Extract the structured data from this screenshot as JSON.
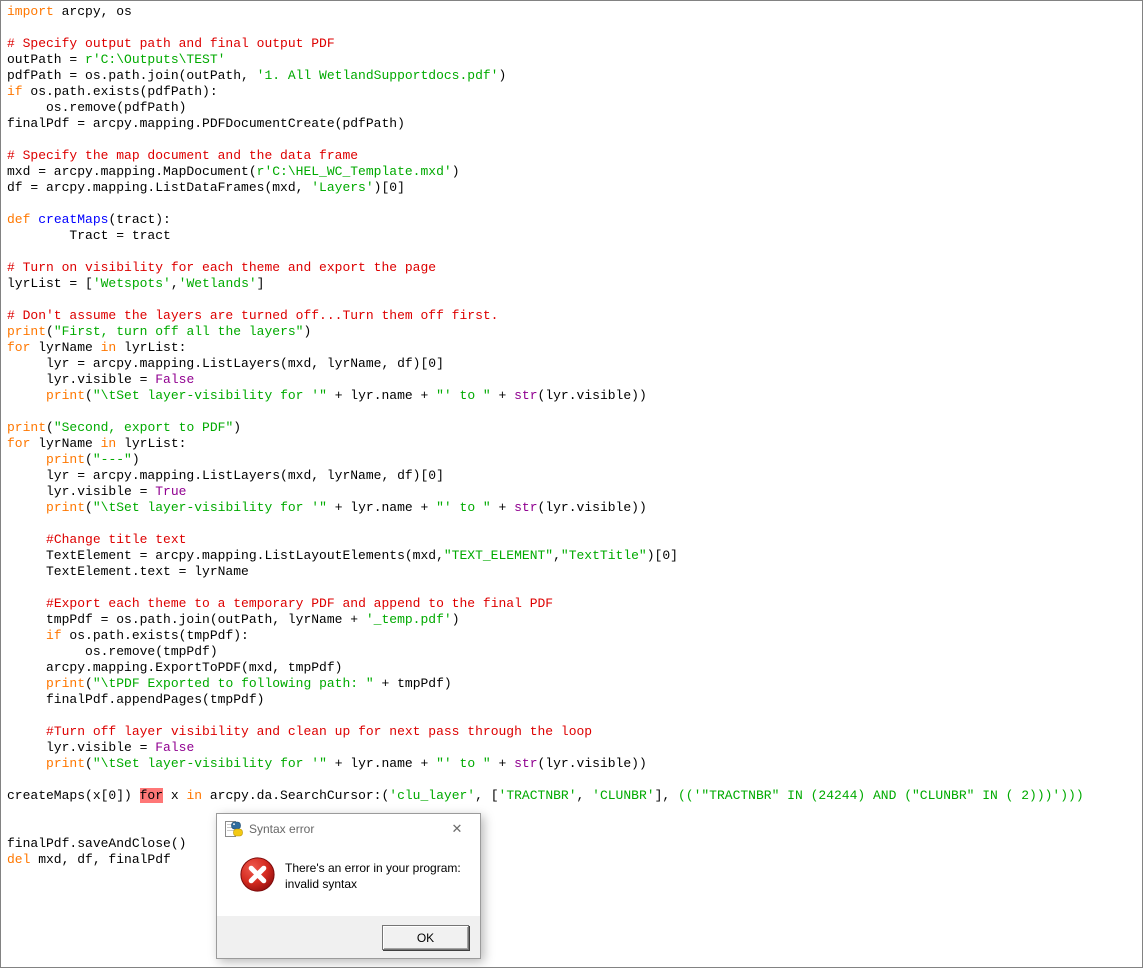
{
  "window": {
    "background": "#ffffff",
    "border_color": "#828282"
  },
  "colors": {
    "plain": "#000000",
    "keyword": "#FF7700",
    "string": "#00AA00",
    "comment": "#DD0000",
    "definition": "#0000FF",
    "builtin": "#900090",
    "error_text": "#000000",
    "error_background": "#FF7777"
  },
  "code": {
    "lines": [
      [
        [
          "k",
          "import"
        ],
        [
          "p",
          " arcpy, os"
        ]
      ],
      [],
      [
        [
          "c",
          "# Specify output path and final output PDF"
        ]
      ],
      [
        [
          "p",
          "outPath = "
        ],
        [
          "s",
          "r'C:\\Outputs\\TEST'"
        ]
      ],
      [
        [
          "p",
          "pdfPath = os.path.join(outPath, "
        ],
        [
          "s",
          "'1. All WetlandSupportdocs.pdf'"
        ],
        [
          "p",
          ")"
        ]
      ],
      [
        [
          "k",
          "if"
        ],
        [
          "p",
          " os.path.exists(pdfPath):"
        ]
      ],
      [
        [
          "p",
          "     os.remove(pdfPath)"
        ]
      ],
      [
        [
          "p",
          "finalPdf = arcpy.mapping.PDFDocumentCreate(pdfPath)"
        ]
      ],
      [],
      [
        [
          "c",
          "# Specify the map document and the data frame"
        ]
      ],
      [
        [
          "p",
          "mxd = arcpy.mapping.MapDocument("
        ],
        [
          "s",
          "r'C:\\HEL_WC_Template.mxd'"
        ],
        [
          "p",
          ")"
        ]
      ],
      [
        [
          "p",
          "df = arcpy.mapping.ListDataFrames(mxd, "
        ],
        [
          "s",
          "'Layers'"
        ],
        [
          "p",
          ")[0]"
        ]
      ],
      [],
      [
        [
          "k",
          "def"
        ],
        [
          "p",
          " "
        ],
        [
          "d",
          "creatMaps"
        ],
        [
          "p",
          "(tract):"
        ]
      ],
      [
        [
          "p",
          "        Tract = tract"
        ]
      ],
      [],
      [
        [
          "c",
          "# Turn on visibility for each theme and export the page"
        ]
      ],
      [
        [
          "p",
          "lyrList = ["
        ],
        [
          "s",
          "'Wetspots'"
        ],
        [
          "p",
          ","
        ],
        [
          "s",
          "'Wetlands'"
        ],
        [
          "p",
          "]"
        ]
      ],
      [],
      [
        [
          "c",
          "# Don't assume the layers are turned off...Turn them off first."
        ]
      ],
      [
        [
          "k",
          "print"
        ],
        [
          "p",
          "("
        ],
        [
          "s",
          "\"First, turn off all the layers\""
        ],
        [
          "p",
          ")"
        ]
      ],
      [
        [
          "k",
          "for"
        ],
        [
          "p",
          " lyrName "
        ],
        [
          "k",
          "in"
        ],
        [
          "p",
          " lyrList:"
        ]
      ],
      [
        [
          "p",
          "     lyr = arcpy.mapping.ListLayers(mxd, lyrName, df)[0]"
        ]
      ],
      [
        [
          "p",
          "     lyr.visible = "
        ],
        [
          "b",
          "False"
        ]
      ],
      [
        [
          "p",
          "     "
        ],
        [
          "k",
          "print"
        ],
        [
          "p",
          "("
        ],
        [
          "s",
          "\"\\tSet layer-visibility for '\""
        ],
        [
          "p",
          " + lyr.name + "
        ],
        [
          "s",
          "\"' to \""
        ],
        [
          "p",
          " + "
        ],
        [
          "b",
          "str"
        ],
        [
          "p",
          "(lyr.visible))"
        ]
      ],
      [],
      [
        [
          "k",
          "print"
        ],
        [
          "p",
          "("
        ],
        [
          "s",
          "\"Second, export to PDF\""
        ],
        [
          "p",
          ")"
        ]
      ],
      [
        [
          "k",
          "for"
        ],
        [
          "p",
          " lyrName "
        ],
        [
          "k",
          "in"
        ],
        [
          "p",
          " lyrList:"
        ]
      ],
      [
        [
          "p",
          "     "
        ],
        [
          "k",
          "print"
        ],
        [
          "p",
          "("
        ],
        [
          "s",
          "\"---\""
        ],
        [
          "p",
          ")"
        ]
      ],
      [
        [
          "p",
          "     lyr = arcpy.mapping.ListLayers(mxd, lyrName, df)[0]"
        ]
      ],
      [
        [
          "p",
          "     lyr.visible = "
        ],
        [
          "b",
          "True"
        ]
      ],
      [
        [
          "p",
          "     "
        ],
        [
          "k",
          "print"
        ],
        [
          "p",
          "("
        ],
        [
          "s",
          "\"\\tSet layer-visibility for '\""
        ],
        [
          "p",
          " + lyr.name + "
        ],
        [
          "s",
          "\"' to \""
        ],
        [
          "p",
          " + "
        ],
        [
          "b",
          "str"
        ],
        [
          "p",
          "(lyr.visible))"
        ]
      ],
      [],
      [
        [
          "p",
          "     "
        ],
        [
          "c",
          "#Change title text"
        ]
      ],
      [
        [
          "p",
          "     TextElement = arcpy.mapping.ListLayoutElements(mxd,"
        ],
        [
          "s",
          "\"TEXT_ELEMENT\""
        ],
        [
          "p",
          ","
        ],
        [
          "s",
          "\"TextTitle\""
        ],
        [
          "p",
          ")[0]"
        ]
      ],
      [
        [
          "p",
          "     TextElement.text = lyrName"
        ]
      ],
      [],
      [
        [
          "p",
          "     "
        ],
        [
          "c",
          "#Export each theme to a temporary PDF and append to the final PDF"
        ]
      ],
      [
        [
          "p",
          "     tmpPdf = os.path.join(outPath, lyrName + "
        ],
        [
          "s",
          "'_temp.pdf'"
        ],
        [
          "p",
          ")"
        ]
      ],
      [
        [
          "p",
          "     "
        ],
        [
          "k",
          "if"
        ],
        [
          "p",
          " os.path.exists(tmpPdf):"
        ]
      ],
      [
        [
          "p",
          "          os.remove(tmpPdf)"
        ]
      ],
      [
        [
          "p",
          "     arcpy.mapping.ExportToPDF(mxd, tmpPdf)"
        ]
      ],
      [
        [
          "p",
          "     "
        ],
        [
          "k",
          "print"
        ],
        [
          "p",
          "("
        ],
        [
          "s",
          "\"\\tPDF Exported to following path: \""
        ],
        [
          "p",
          " + tmpPdf)"
        ]
      ],
      [
        [
          "p",
          "     finalPdf.appendPages(tmpPdf)"
        ]
      ],
      [],
      [
        [
          "p",
          "     "
        ],
        [
          "c",
          "#Turn off layer visibility and clean up for next pass through the loop"
        ]
      ],
      [
        [
          "p",
          "     lyr.visible = "
        ],
        [
          "b",
          "False"
        ]
      ],
      [
        [
          "p",
          "     "
        ],
        [
          "k",
          "print"
        ],
        [
          "p",
          "("
        ],
        [
          "s",
          "\"\\tSet layer-visibility for '\""
        ],
        [
          "p",
          " + lyr.name + "
        ],
        [
          "s",
          "\"' to \""
        ],
        [
          "p",
          " + "
        ],
        [
          "b",
          "str"
        ],
        [
          "p",
          "(lyr.visible))"
        ]
      ],
      [],
      [
        [
          "p",
          "createMaps(x[0]) "
        ],
        [
          "e",
          "for"
        ],
        [
          "p",
          " x "
        ],
        [
          "k",
          "in"
        ],
        [
          "p",
          " arcpy.da.SearchCursor:("
        ],
        [
          "s",
          "'clu_layer'"
        ],
        [
          "p",
          ", ["
        ],
        [
          "s",
          "'TRACTNBR'"
        ],
        [
          "p",
          ", "
        ],
        [
          "s",
          "'CLUNBR'"
        ],
        [
          "p",
          "], "
        ],
        [
          "s",
          "(('\"TRACTNBR\" IN (24244) AND (\"CLUNBR\" IN ( 2)))')))"
        ]
      ],
      [],
      [],
      [
        [
          "p",
          "finalPdf.saveAndClose()"
        ]
      ],
      [
        [
          "k",
          "del"
        ],
        [
          "p",
          " mxd, df, finalPdf"
        ]
      ]
    ]
  },
  "dialog": {
    "title": "Syntax error",
    "close_icon": "✕",
    "message_line1": "There's an error in your program:",
    "message_line2": "invalid syntax",
    "ok_label": "OK"
  }
}
